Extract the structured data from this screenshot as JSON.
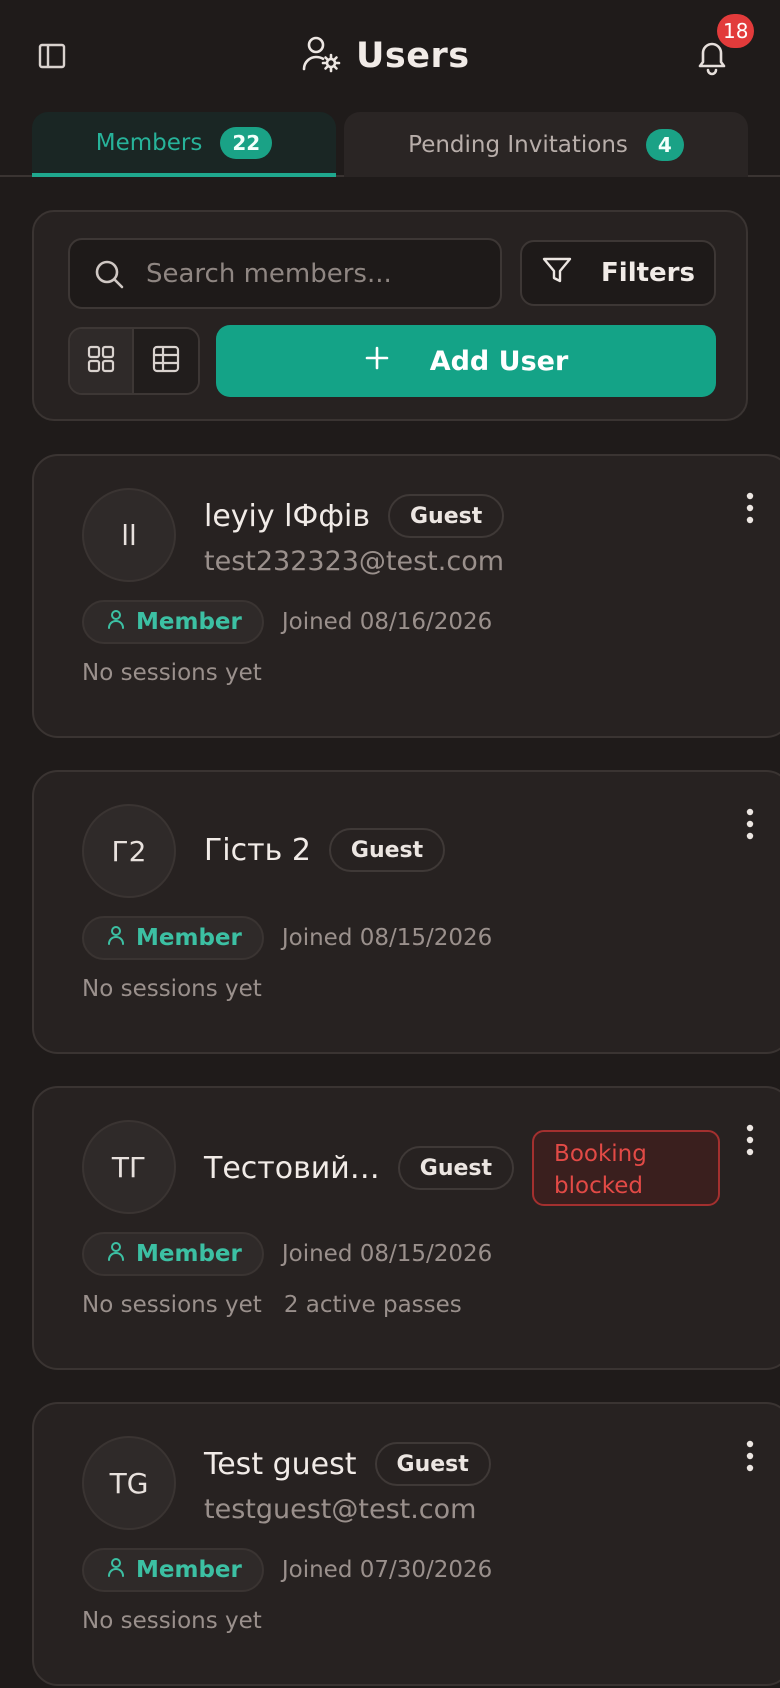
{
  "header": {
    "title": "Users",
    "notification_count": "18"
  },
  "tabs": [
    {
      "label": "Members",
      "count": "22"
    },
    {
      "label": "Pending Invitations",
      "count": "4"
    }
  ],
  "toolbar": {
    "search_placeholder": "Search members...",
    "filters_label": "Filters",
    "add_user_label": "Add User"
  },
  "colors": {
    "accent": "#14a387",
    "background": "#1f1b1a",
    "card": "#272221",
    "danger": "#e24a46"
  },
  "members": [
    {
      "initials": "ll",
      "name": "leyiy lФфів",
      "badge": "Guest",
      "email": "test232323@test.com",
      "role": "Member",
      "joined": "Joined 08/16/2026",
      "sessions": "No sessions yet"
    },
    {
      "initials": "Г2",
      "name": "Гість 2",
      "badge": "Guest",
      "role": "Member",
      "joined": "Joined 08/15/2026",
      "sessions": "No sessions yet"
    },
    {
      "initials": "ТГ",
      "name": "Тестовий…",
      "badge": "Guest",
      "blocked": "Booking blocked",
      "role": "Member",
      "joined": "Joined 08/15/2026",
      "sessions": "No sessions yet",
      "passes": "2 active passes"
    },
    {
      "initials": "TG",
      "name": "Test guest",
      "badge": "Guest",
      "email": "testguest@test.com",
      "role": "Member",
      "joined": "Joined 07/30/2026",
      "sessions": "No sessions yet"
    }
  ]
}
